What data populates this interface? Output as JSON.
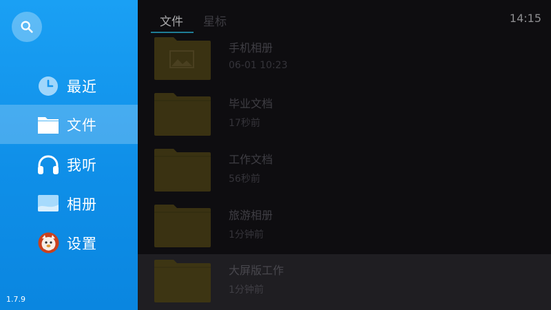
{
  "sidebar": {
    "version": "1.7.9",
    "items": [
      {
        "label": "最近",
        "icon": "clock-icon",
        "active": false
      },
      {
        "label": "文件",
        "icon": "folder-icon",
        "active": true
      },
      {
        "label": "我听",
        "icon": "headphones-icon",
        "active": false
      },
      {
        "label": "相册",
        "icon": "photo-album-icon",
        "active": false
      },
      {
        "label": "设置",
        "icon": "mascot-avatar-icon",
        "active": false
      }
    ]
  },
  "header": {
    "tabs": [
      {
        "label": "文件",
        "selected": true
      },
      {
        "label": "星标",
        "selected": false
      }
    ],
    "time": "14:15"
  },
  "files": [
    {
      "name": "手机相册",
      "time": "06-01 10:23",
      "icon": "photo-folder-icon"
    },
    {
      "name": "毕业文档",
      "time": "17秒前",
      "icon": "folder-icon"
    },
    {
      "name": "工作文档",
      "time": "56秒前",
      "icon": "folder-icon"
    },
    {
      "name": "旅游相册",
      "time": "1分钟前",
      "icon": "folder-icon"
    },
    {
      "name": "大屏版工作",
      "time": "1分钟前",
      "icon": "folder-icon",
      "focused": true
    }
  ],
  "colors": {
    "sidebar": "#1aa0f4",
    "folder": "#3a3212",
    "background": "#0e0d10",
    "tab_underline": "#1f7d96"
  }
}
